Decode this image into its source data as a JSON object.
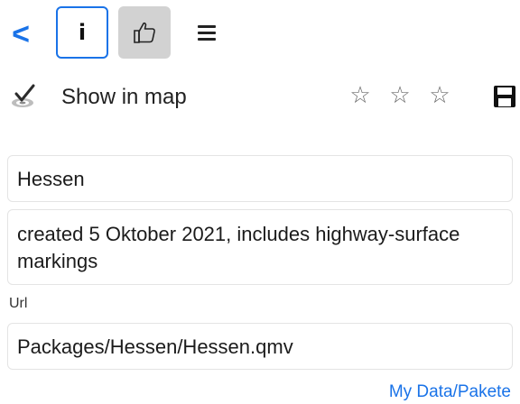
{
  "toolbar": {
    "back_label": "<",
    "info_glyph": "i",
    "buttons": {
      "info": {
        "icon": "info-icon",
        "selected": true
      },
      "like": {
        "icon": "thumbs-up-icon",
        "active_bg": "#d2d2d2"
      },
      "menu": {
        "icon": "hamburger-menu-icon"
      }
    }
  },
  "map_row": {
    "checked": true,
    "label": "Show in map",
    "rating": {
      "max": 3,
      "value": 0
    },
    "save_icon": "save-icon"
  },
  "fields": {
    "name": "Hessen",
    "description": "created 5 Oktober 2021, includes highway-surface markings",
    "url_label": "Url",
    "url": "Packages/Hessen/Hessen.qmv"
  },
  "footer": {
    "link_label": "My Data/Pakete"
  },
  "colors": {
    "accent": "#1a73e8",
    "border": "#e4e4e4"
  }
}
